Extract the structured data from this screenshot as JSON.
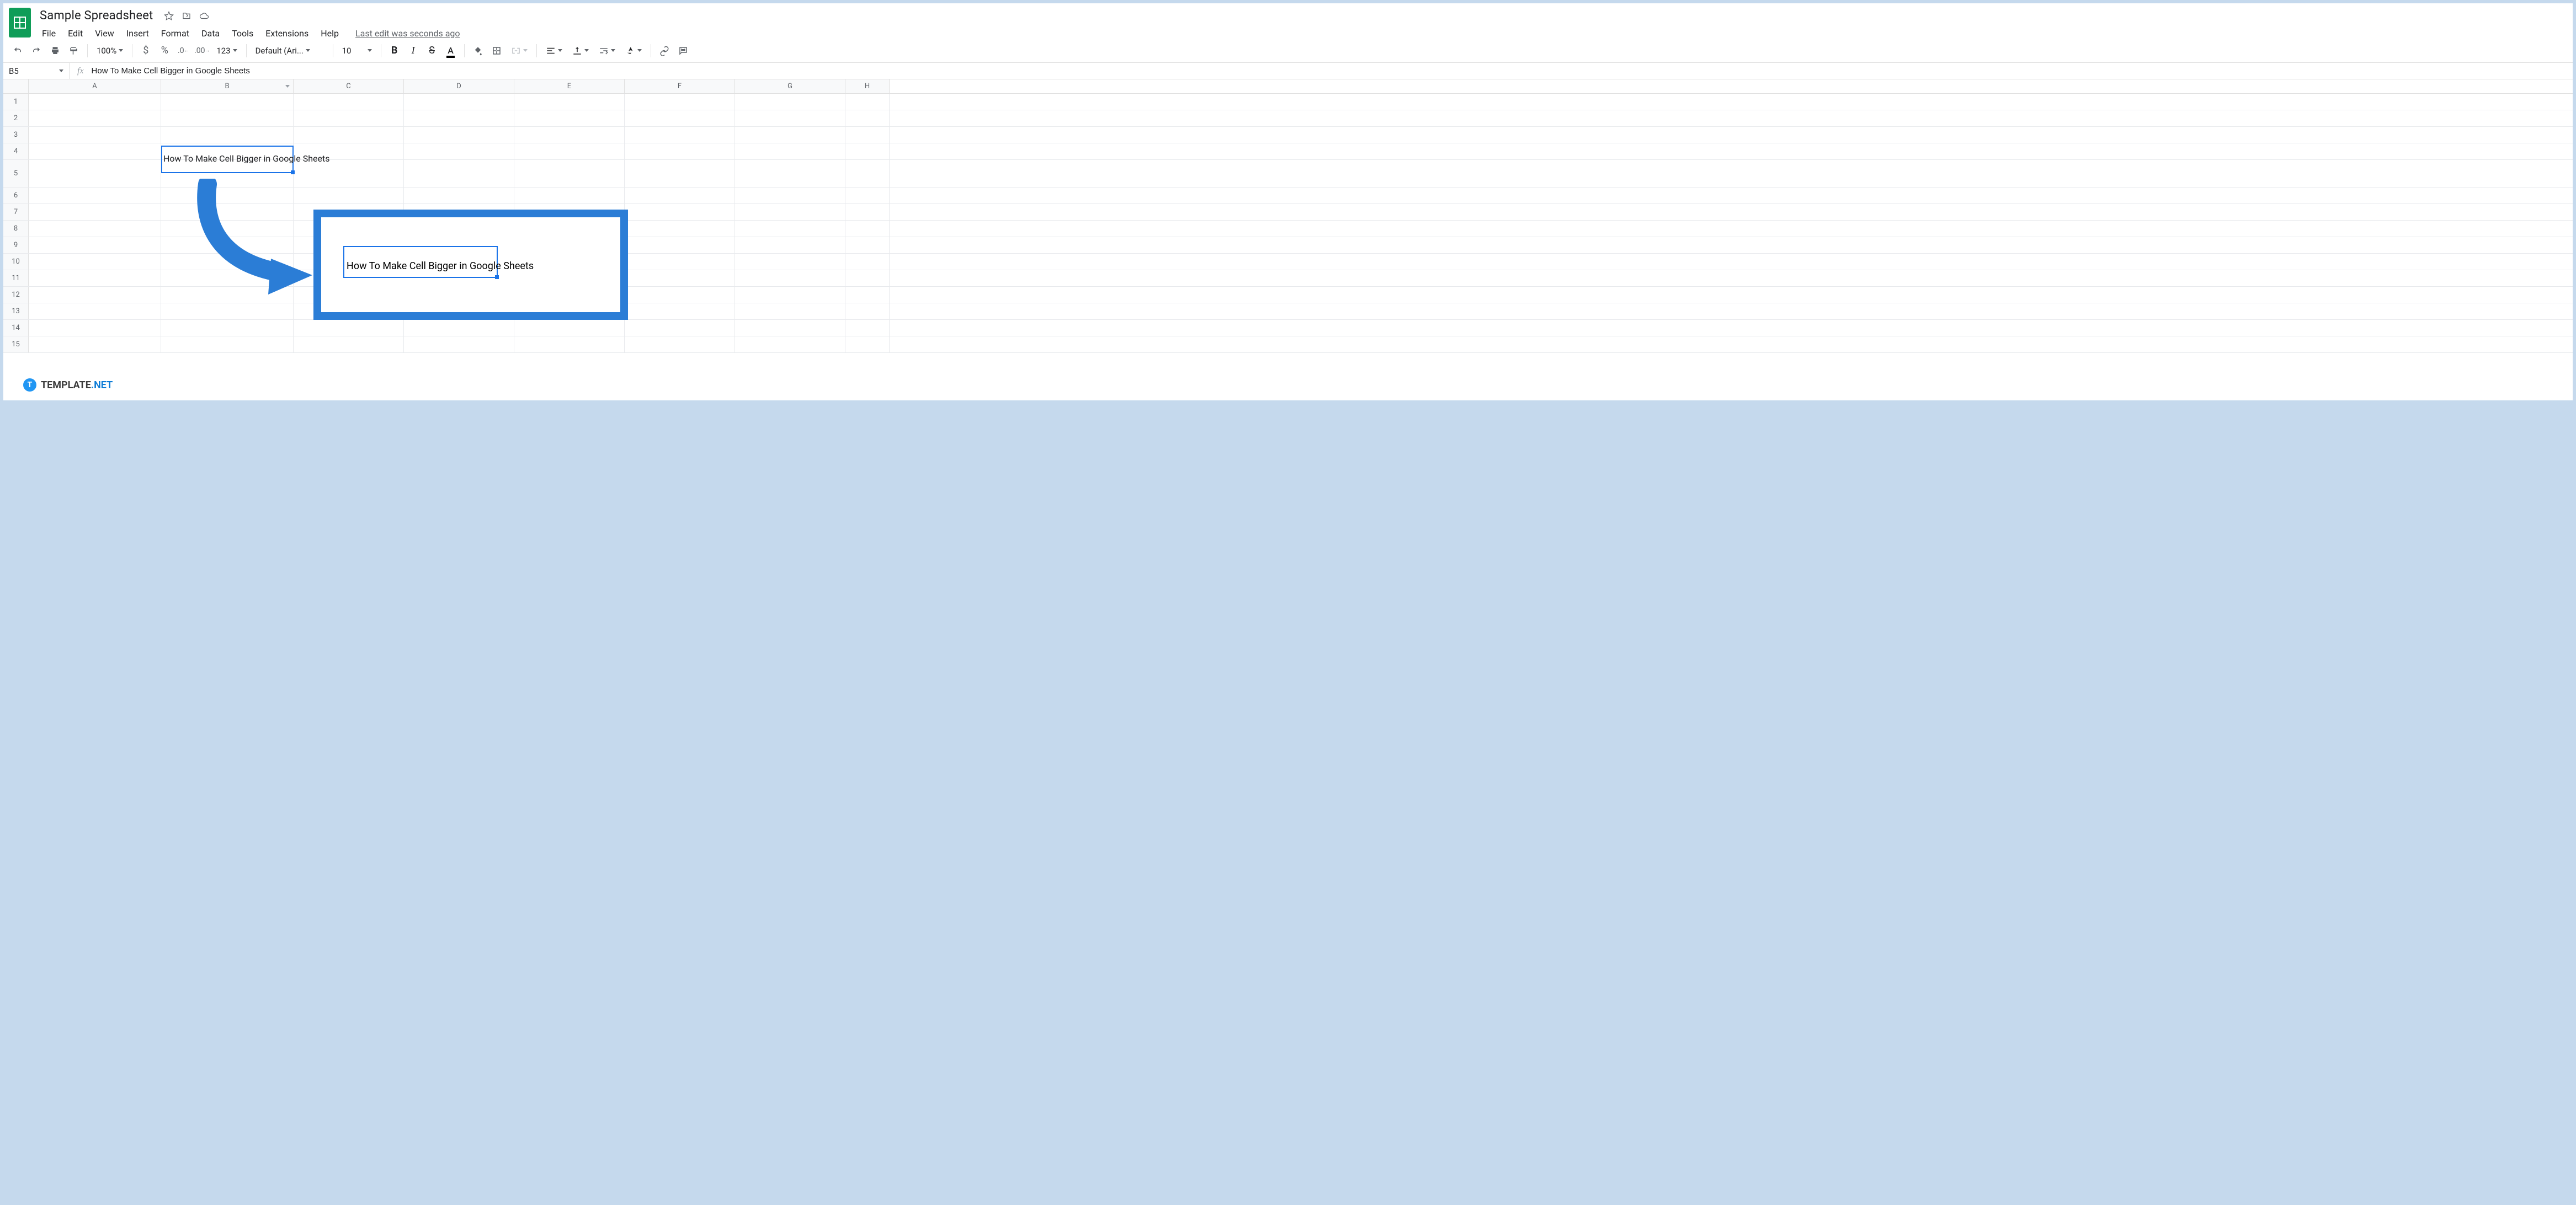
{
  "header": {
    "doc_title": "Sample Spreadsheet",
    "last_edit": "Last edit was seconds ago"
  },
  "menubar": {
    "items": [
      "File",
      "Edit",
      "View",
      "Insert",
      "Format",
      "Data",
      "Tools",
      "Extensions",
      "Help"
    ]
  },
  "toolbar": {
    "zoom": "100%",
    "currency": "$",
    "percent": "%",
    "dec_dec": ".0",
    "inc_dec": ".00",
    "more_formats": "123",
    "font": "Default (Ari...",
    "font_size": "10"
  },
  "formula": {
    "name_box": "B5",
    "fx": "fx",
    "value": "How To Make Cell Bigger in Google Sheets"
  },
  "columns": [
    "A",
    "B",
    "C",
    "D",
    "E",
    "F",
    "G",
    "H"
  ],
  "rows": [
    "1",
    "2",
    "3",
    "4",
    "5",
    "6",
    "7",
    "8",
    "9",
    "10",
    "11",
    "12",
    "13",
    "14",
    "15"
  ],
  "cells": {
    "B5": "How To Make Cell Bigger in Google Sheets"
  },
  "callout": {
    "text": "How To Make Cell Bigger in Google Sheets"
  },
  "watermark": {
    "badge": "T",
    "brand": "TEMPLATE",
    "suffix": ".NET"
  }
}
